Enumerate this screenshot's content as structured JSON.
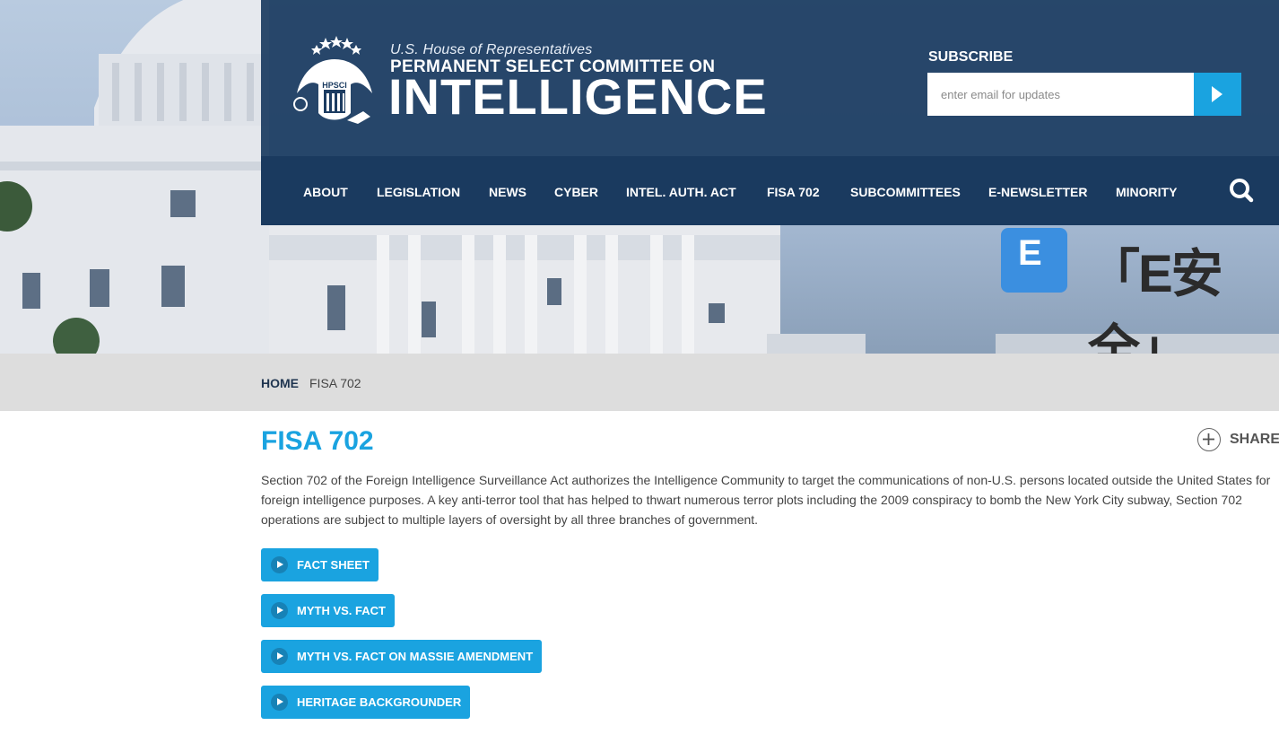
{
  "header": {
    "house_line": "U.S. House of Representatives",
    "committee_line": "PERMANENT SELECT COMMITTEE ON",
    "intelligence_line": "INTELLIGENCE",
    "seal_text": "HPSCI"
  },
  "subscribe": {
    "label": "SUBSCRIBE",
    "placeholder": "enter email for updates"
  },
  "nav": [
    {
      "label": "ABOUT"
    },
    {
      "label": "LEGISLATION"
    },
    {
      "label": "NEWS"
    },
    {
      "label": "CYBER"
    },
    {
      "label": "INTEL. AUTH. ACT"
    },
    {
      "label": "FISA 702"
    },
    {
      "label": "SUBCOMMITTEES"
    },
    {
      "label": "E-NEWSLETTER"
    },
    {
      "label": "MINORITY"
    }
  ],
  "watermark": {
    "badge_letter": "E",
    "text": "「E安全」"
  },
  "breadcrumb": {
    "home": "HOME",
    "current": "FISA 702"
  },
  "page": {
    "title": "FISA 702",
    "share_label": "SHARE",
    "intro": "Section 702 of the Foreign Intelligence Surveillance Act authorizes the Intelligence Community to target the communications of non-U.S. persons located outside the United States for foreign intelligence purposes. A key anti-terror tool that has helped to thwart numerous terror plots including the 2009 conspiracy to bomb the New York City subway, Section 702 operations are subject to multiple layers of oversight by all three branches of government."
  },
  "documents": [
    {
      "label": "FACT SHEET"
    },
    {
      "label": "MYTH VS. FACT"
    },
    {
      "label": "MYTH VS. FACT ON MASSIE AMENDMENT"
    },
    {
      "label": "HERITAGE BACKGROUNDER"
    }
  ],
  "colors": {
    "header_navy": "#1c3c61",
    "nav_navy": "#1a3a5f",
    "accent_blue": "#1aa3e0",
    "breadcrumb_gray": "#dddddd"
  }
}
